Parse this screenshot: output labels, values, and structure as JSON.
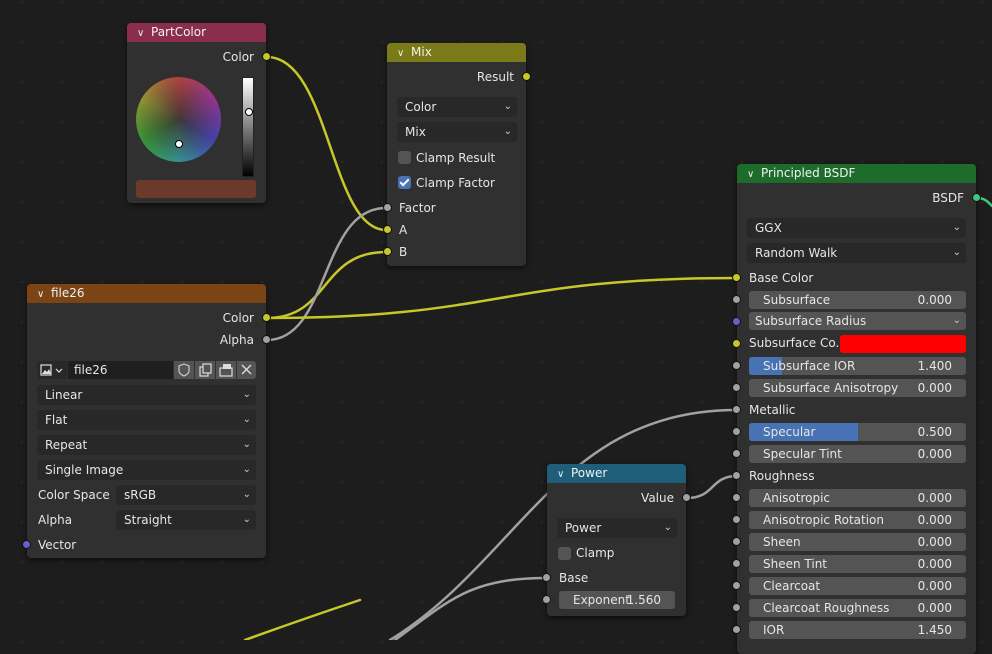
{
  "colors": {
    "socket_color": "#c7c729",
    "socket_float": "#a1a1a1",
    "socket_vector": "#6363c7",
    "socket_shader": "#3fc77e",
    "header_partcolor": "#8a2e4c",
    "header_mix": "#7a7a18",
    "header_file": "#7a4414",
    "header_power": "#1e5e78",
    "header_bsdf": "#1e6c2c",
    "subsurface_color_swatch": "#ff0000",
    "partcolor_swatch": "#6b3a2a"
  },
  "partcolor": {
    "title": "PartColor",
    "out_color": "Color",
    "icons": {
      "collapse": "chevron-down-icon"
    }
  },
  "mix": {
    "title": "Mix",
    "out_result": "Result",
    "data_type": "Color",
    "blend_mode": "Mix",
    "clamp_result_label": "Clamp Result",
    "clamp_result": false,
    "clamp_factor_label": "Clamp Factor",
    "clamp_factor": true,
    "in_factor": "Factor",
    "in_a": "A",
    "in_b": "B"
  },
  "file": {
    "title": "file26",
    "out_color": "Color",
    "out_alpha": "Alpha",
    "image_name": "file26",
    "interpolation": "Linear",
    "projection": "Flat",
    "extension": "Repeat",
    "source": "Single Image",
    "color_space_label": "Color Space",
    "color_space": "sRGB",
    "alpha_label": "Alpha",
    "alpha_mode": "Straight",
    "in_vector": "Vector",
    "icons": [
      "image-icon",
      "shield-icon",
      "duplicate-icon",
      "open-file-icon",
      "close-icon"
    ]
  },
  "power": {
    "title": "Power",
    "out_value": "Value",
    "operation": "Power",
    "clamp_label": "Clamp",
    "clamp": false,
    "in_base": "Base",
    "exponent_label": "Exponent",
    "exponent_value": "1.560"
  },
  "bsdf": {
    "title": "Principled BSDF",
    "out_bsdf": "BSDF",
    "distribution": "GGX",
    "subsurface_method": "Random Walk",
    "base_color": "Base Color",
    "subsurface_label": "Subsurface",
    "subsurface_value": "0.000",
    "subsurface_radius": "Subsurface Radius",
    "subsurface_color_label": "Subsurface Co...",
    "subsurface_ior_label": "Subsurface IOR",
    "subsurface_ior_value": "1.400",
    "subsurface_ior_fill": 0.15,
    "subsurface_aniso_label": "Subsurface Anisotropy",
    "subsurface_aniso_value": "0.000",
    "metallic": "Metallic",
    "specular_label": "Specular",
    "specular_value": "0.500",
    "specular_fill": 0.5,
    "specular_tint_label": "Specular Tint",
    "specular_tint_value": "0.000",
    "roughness": "Roughness",
    "anisotropic_label": "Anisotropic",
    "anisotropic_value": "0.000",
    "aniso_rot_label": "Anisotropic Rotation",
    "aniso_rot_value": "0.000",
    "sheen_label": "Sheen",
    "sheen_value": "0.000",
    "sheen_tint_label": "Sheen Tint",
    "sheen_tint_value": "0.000",
    "clearcoat_label": "Clearcoat",
    "clearcoat_value": "0.000",
    "clearcoat_rough_label": "Clearcoat Roughness",
    "clearcoat_rough_value": "0.000",
    "ior_label": "IOR",
    "ior_value": "1.450"
  }
}
